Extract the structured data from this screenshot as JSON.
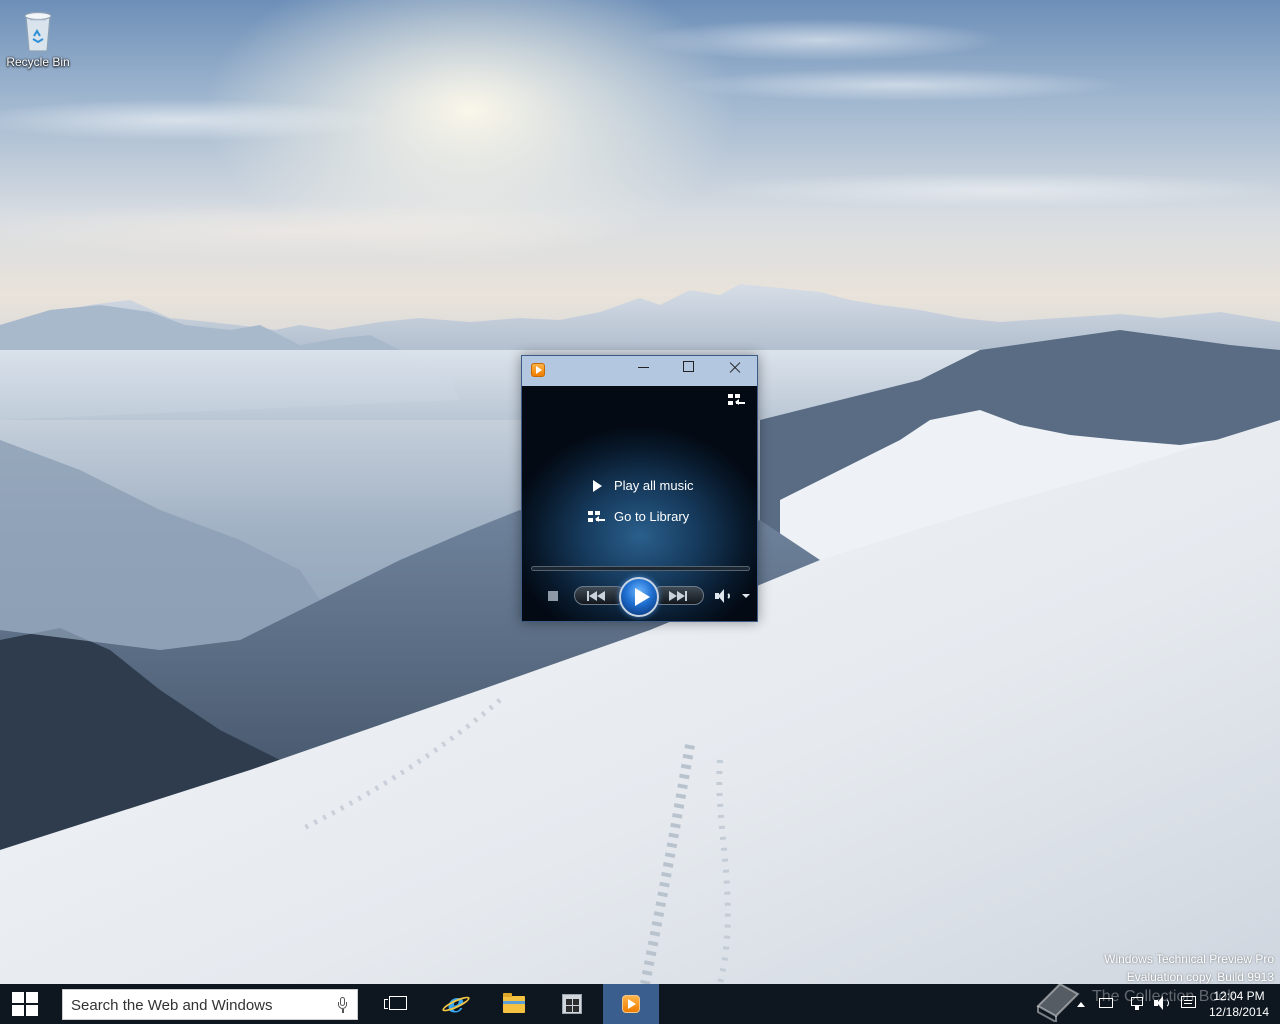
{
  "desktop": {
    "icons": [
      {
        "label": "Recycle Bin",
        "icon": "recycle-bin-icon"
      }
    ],
    "watermark": {
      "line1": "Windows Technical Preview Pro",
      "line2": "Evaluation copy. Build 9913"
    },
    "overlay_text": "The Collection Book"
  },
  "media_player": {
    "app_icon": "windows-media-player-icon",
    "titlebar": {
      "minimize": "minimize-icon",
      "maximize": "maximize-icon",
      "close": "close-icon"
    },
    "commands": {
      "play_all": "Play all music",
      "go_library": "Go to Library"
    },
    "controls": [
      "stop",
      "previous",
      "play",
      "next",
      "mute",
      "volume-dropdown"
    ],
    "accent_color": "#1f6fd1"
  },
  "taskbar": {
    "search": {
      "placeholder": "Search the Web and Windows"
    },
    "apps": [
      "task-view-icon",
      "internet-explorer-icon",
      "file-explorer-icon",
      "store-icon",
      "windows-media-player-icon"
    ],
    "active_app": "windows-media-player-icon",
    "clock": {
      "time": "12:04 PM",
      "date": "12/18/2014"
    },
    "background_color": "#0e1620"
  }
}
